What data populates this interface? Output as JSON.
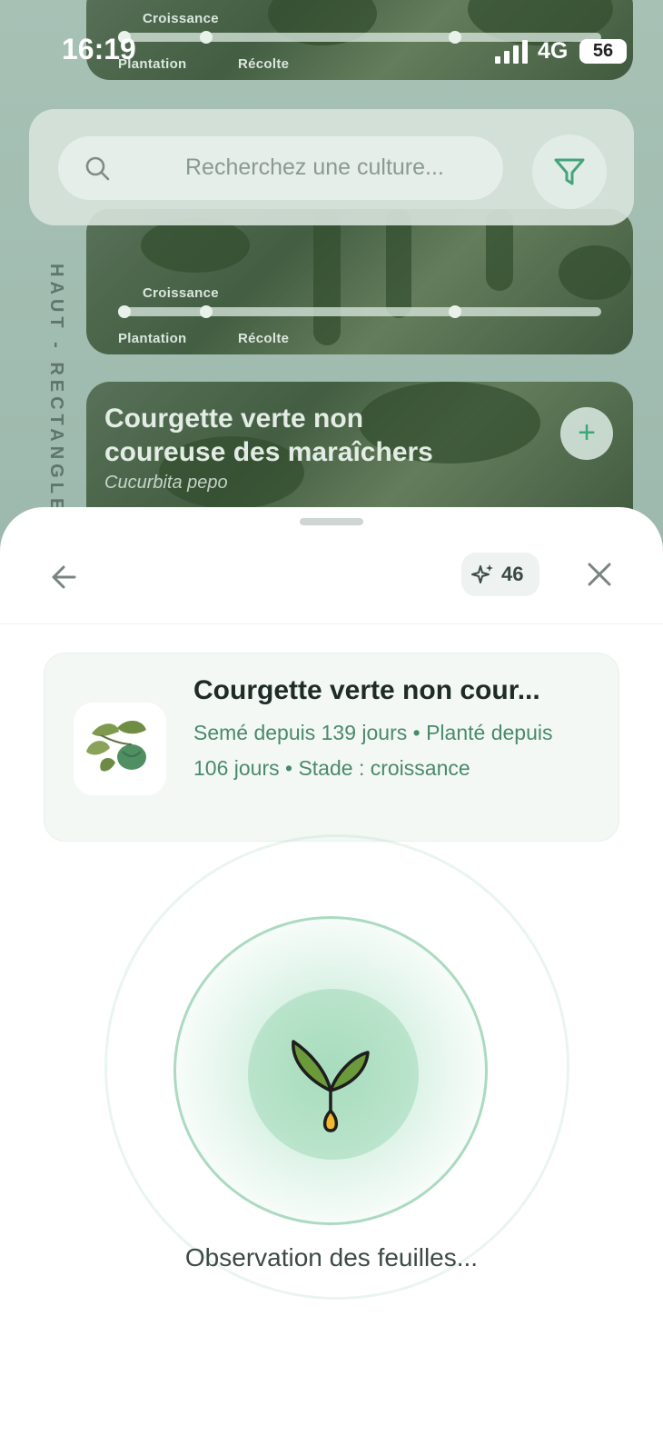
{
  "status_bar": {
    "time": "16:19",
    "network": "4G",
    "battery": "56"
  },
  "background": {
    "search": {
      "placeholder": "Recherchez une culture..."
    },
    "vertical_label": "HAUT - RECTANGLE L",
    "card_top": {
      "stage_label": "Croissance",
      "start_label": "Plantation",
      "end_label": "Récolte"
    },
    "card_mid": {
      "stage_label": "Croissance",
      "start_label": "Plantation",
      "end_label": "Récolte"
    },
    "card_bottom": {
      "title": "Courgette verte non coureuse des maraîchers",
      "subtitle": "Cucurbita pepo",
      "add_icon": "plus-icon"
    }
  },
  "sheet": {
    "credits": "46",
    "plant": {
      "name": "Courgette verte non cour...",
      "info": "Semé depuis 139 jours • Planté depuis 106 jours • Stade : croissance"
    },
    "scan_status": "Observation des feuilles..."
  },
  "colors": {
    "accent": "#4a8a6a",
    "sheet_bg": "#ffffff",
    "ring": "#78c39b"
  }
}
